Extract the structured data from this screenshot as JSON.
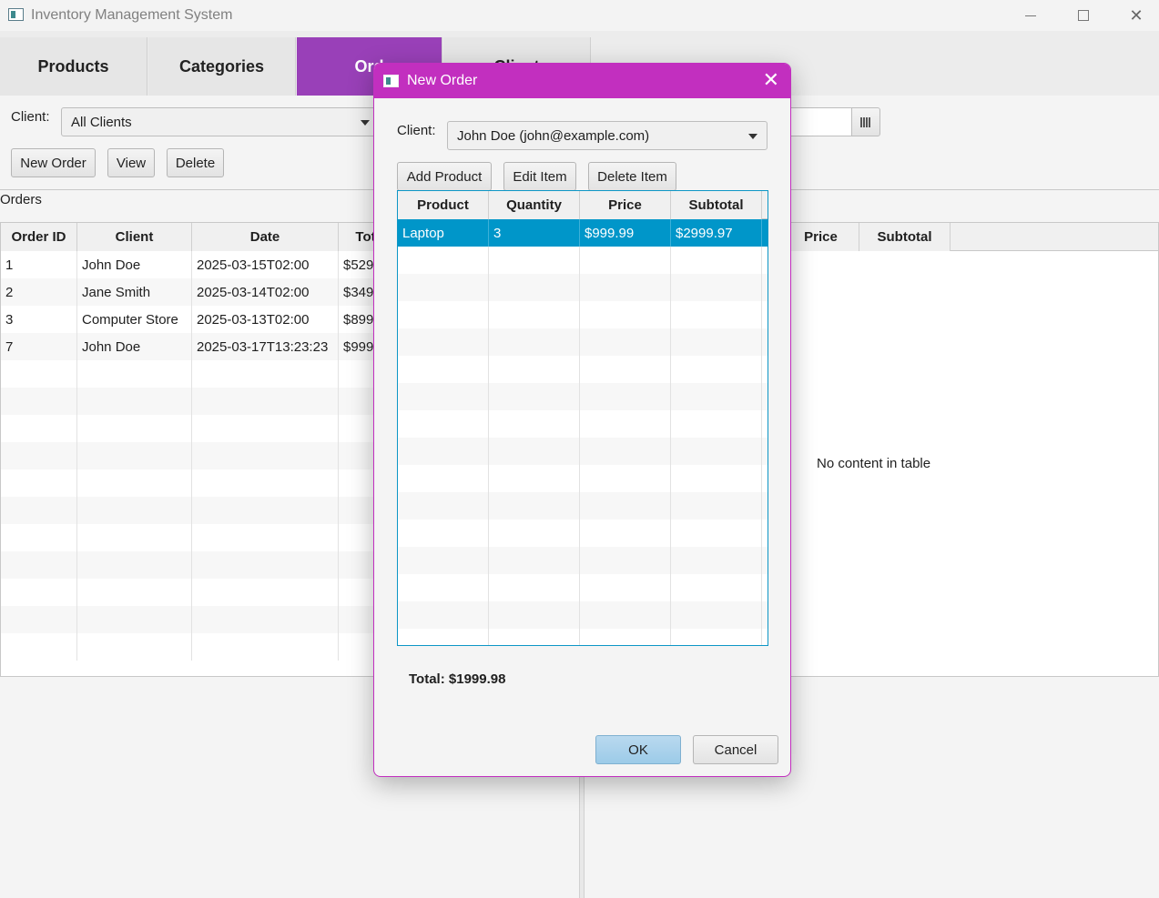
{
  "window": {
    "title": "Inventory Management System"
  },
  "tabs": [
    {
      "label": "Products"
    },
    {
      "label": "Categories"
    },
    {
      "label": "Ord"
    },
    {
      "label": "Client"
    }
  ],
  "filters": {
    "client_label": "Client:",
    "client_value": "All Clients"
  },
  "toolbar": {
    "new_order": "New Order",
    "view": "View",
    "delete": "Delete"
  },
  "orders": {
    "label": "Orders",
    "columns": [
      "Order ID",
      "Client",
      "Date",
      "Tot"
    ],
    "rows": [
      [
        "1",
        "John Doe",
        "2025-03-15T02:00",
        "$529."
      ],
      [
        "2",
        "Jane Smith",
        "2025-03-14T02:00",
        "$349."
      ],
      [
        "3",
        "Computer Store",
        "2025-03-13T02:00",
        "$899."
      ],
      [
        "7",
        "John Doe",
        "2025-03-17T13:23:23",
        "$999."
      ]
    ]
  },
  "details": {
    "columns": [
      "Price",
      "Subtotal"
    ],
    "empty_message": "No content in table"
  },
  "dialog": {
    "title": "New Order",
    "client_label": "Client:",
    "client_value": "John Doe (john@example.com)",
    "buttons": {
      "add": "Add Product",
      "edit": "Edit Item",
      "delete": "Delete Item"
    },
    "columns": [
      "Product",
      "Quantity",
      "Price",
      "Subtotal"
    ],
    "rows": [
      [
        "Laptop",
        "3",
        "$999.99",
        "$2999.97"
      ]
    ],
    "total": "Total: $1999.98",
    "ok": "OK",
    "cancel": "Cancel"
  },
  "colors": {
    "accent": "#9940b8",
    "dialog_title": "#c22fbf",
    "selection": "#0096c9"
  }
}
